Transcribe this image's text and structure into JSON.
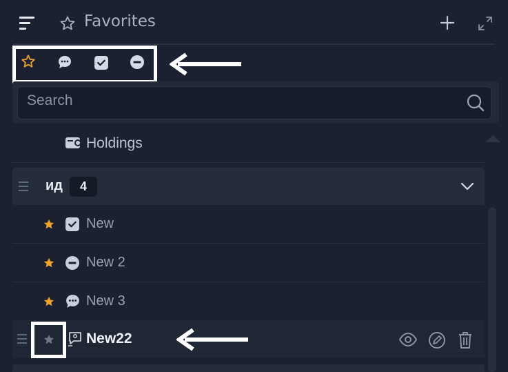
{
  "header": {
    "title": "Favorites",
    "icons": [
      "menu-icon",
      "star-outline-icon",
      "plus-icon",
      "expand-icon"
    ]
  },
  "filters": [
    {
      "name": "star-filter",
      "icon": "star-outline-icon",
      "active": true
    },
    {
      "name": "chat-filter",
      "icon": "chat-bubble-icon"
    },
    {
      "name": "check-filter",
      "icon": "checkbox-icon"
    },
    {
      "name": "minus-filter",
      "icon": "minus-circle-icon"
    }
  ],
  "search": {
    "placeholder": "Search"
  },
  "list": {
    "holdings": {
      "label": "Holdings",
      "icon": "wallet-icon"
    },
    "group": {
      "name": "ид",
      "count": "4"
    },
    "items": [
      {
        "label": "New",
        "icon": "checkbox-icon"
      },
      {
        "label": "New 2",
        "icon": "minus-circle-icon"
      },
      {
        "label": "New 3",
        "icon": "chat-bubble-icon"
      }
    ],
    "selected": {
      "label": "New22",
      "icon": "chat-person-icon",
      "actions": [
        "eye-icon",
        "edit-icon",
        "trash-icon"
      ]
    }
  },
  "colors": {
    "background": "#1b2130",
    "accent_star": "#f0a32a",
    "annotation": "#ffffff"
  }
}
